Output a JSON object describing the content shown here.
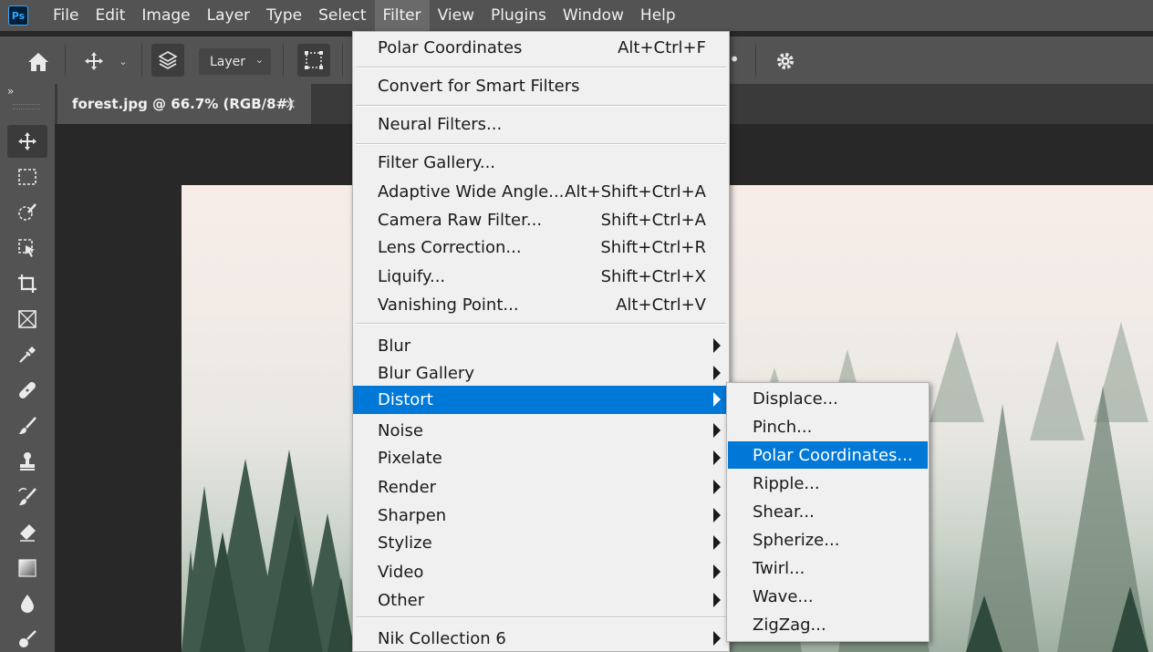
{
  "app": {
    "logo_text": "Ps",
    "menu": [
      "File",
      "Edit",
      "Image",
      "Layer",
      "Type",
      "Select",
      "Filter",
      "View",
      "Plugins",
      "Window",
      "Help"
    ],
    "active_menu": "Filter"
  },
  "options_bar": {
    "layer_select_value": "Layer"
  },
  "document_tab": {
    "title": "forest.jpg @ 66.7% (RGB/8#)",
    "close_glyph": "×"
  },
  "panel_collapse_glyph": "»",
  "filter_menu": {
    "items": [
      {
        "label": "Polar Coordinates",
        "shortcut": "Alt+Ctrl+F"
      },
      {
        "label": "Convert for Smart Filters",
        "shortcut": ""
      },
      {
        "label": "Neural Filters...",
        "shortcut": ""
      },
      {
        "label": "Filter Gallery...",
        "shortcut": ""
      },
      {
        "label": "Adaptive Wide Angle...",
        "shortcut": "Alt+Shift+Ctrl+A"
      },
      {
        "label": "Camera Raw Filter...",
        "shortcut": "Shift+Ctrl+A"
      },
      {
        "label": "Lens Correction...",
        "shortcut": "Shift+Ctrl+R"
      },
      {
        "label": "Liquify...",
        "shortcut": "Shift+Ctrl+X"
      },
      {
        "label": "Vanishing Point...",
        "shortcut": "Alt+Ctrl+V"
      },
      {
        "label": "Blur",
        "submenu": true
      },
      {
        "label": "Blur Gallery",
        "submenu": true
      },
      {
        "label": "Distort",
        "submenu": true,
        "highlighted": true
      },
      {
        "label": "Noise",
        "submenu": true
      },
      {
        "label": "Pixelate",
        "submenu": true
      },
      {
        "label": "Render",
        "submenu": true
      },
      {
        "label": "Sharpen",
        "submenu": true
      },
      {
        "label": "Stylize",
        "submenu": true
      },
      {
        "label": "Video",
        "submenu": true
      },
      {
        "label": "Other",
        "submenu": true
      },
      {
        "label": "Nik Collection 6",
        "submenu": true
      }
    ]
  },
  "distort_submenu": {
    "items": [
      "Displace...",
      "Pinch...",
      "Polar Coordinates...",
      "Ripple...",
      "Shear...",
      "Spherize...",
      "Twirl...",
      "Wave...",
      "ZigZag..."
    ],
    "highlighted": "Polar Coordinates..."
  },
  "colors": {
    "highlight": "#0078d7",
    "menu_bg": "#f0f0f0",
    "chrome": "#535353"
  }
}
